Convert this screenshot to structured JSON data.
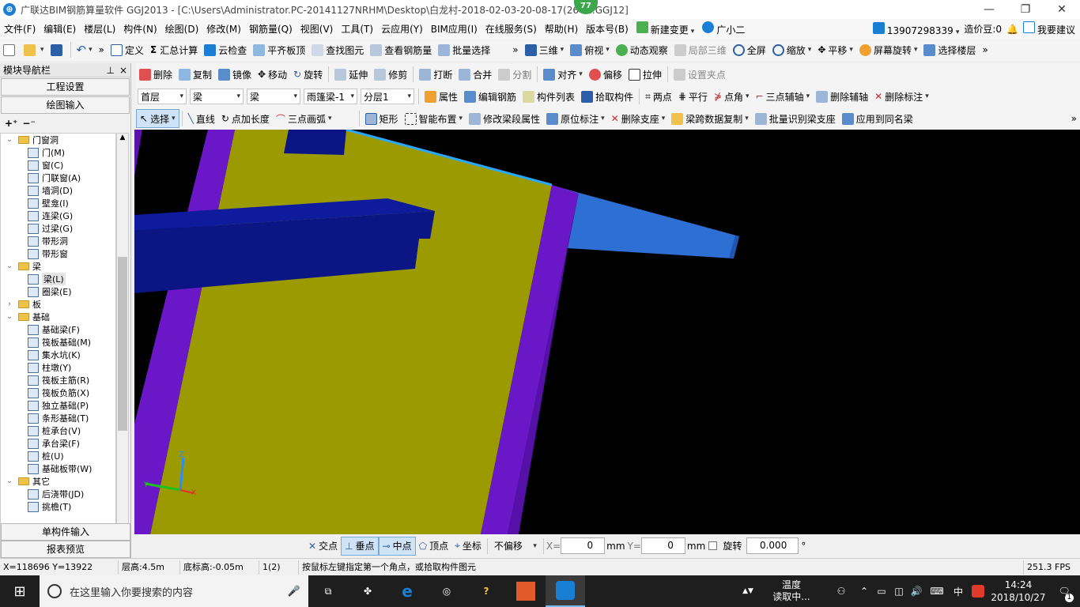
{
  "window": {
    "title": "广联达BIM钢筋算量软件 GGJ2013 - [C:\\Users\\Administrator.PC-20141127NRHM\\Desktop\\白龙村-2018-02-03-20-08-17(26G...GGJ12]",
    "badge": "77",
    "logo_glyph": "⊕"
  },
  "menu": {
    "items": [
      "文件(F)",
      "编辑(E)",
      "楼层(L)",
      "构件(N)",
      "绘图(D)",
      "修改(M)",
      "钢筋量(Q)",
      "视图(V)",
      "工具(T)",
      "云应用(Y)",
      "BIM应用(I)",
      "在线服务(S)",
      "帮助(H)",
      "版本号(B)"
    ],
    "new_change": "新建变更",
    "assistant": "广小二",
    "phone": "13907298339",
    "beans": "造价豆:0",
    "feedback": "我要建议"
  },
  "toolbar1": {
    "items": [
      "定义",
      "汇总计算",
      "云检查",
      "平齐板顶",
      "查找图元",
      "查看钢筋量",
      "批量选择"
    ],
    "view_items": [
      "三维",
      "俯视",
      "动态观察",
      "局部三维",
      "全屏",
      "缩放",
      "平移",
      "屏幕旋转",
      "选择楼层"
    ]
  },
  "toolbar2": {
    "items": [
      "删除",
      "复制",
      "镜像",
      "移动",
      "旋转",
      "延伸",
      "修剪",
      "打断",
      "合并",
      "分割",
      "对齐",
      "偏移",
      "拉伸",
      "设置夹点"
    ]
  },
  "toolbar3": {
    "floor": "首层",
    "type1": "梁",
    "type2": "梁",
    "component": "雨篷梁-1",
    "layer": "分层1",
    "items": [
      "属性",
      "编辑钢筋",
      "构件列表",
      "拾取构件",
      "两点",
      "平行",
      "点角",
      "三点辅轴",
      "删除辅轴",
      "删除标注"
    ]
  },
  "toolbar4": {
    "items": [
      "选择",
      "直线",
      "点加长度",
      "三点画弧",
      "矩形",
      "智能布置",
      "修改梁段属性",
      "原位标注",
      "删除支座",
      "梁跨数据复制",
      "批量识别梁支座",
      "应用到同名梁"
    ]
  },
  "nav": {
    "title": "模块导航栏",
    "pin": "ᅟ",
    "close": "×",
    "btn_project": "工程设置",
    "btn_draw": "绘图输入",
    "btn_single": "单构件输入",
    "btn_report": "报表预览",
    "tree": [
      {
        "label": "门窗洞",
        "type": "folder",
        "open": true,
        "level": 0
      },
      {
        "label": "门(M)",
        "type": "leaf",
        "level": 1
      },
      {
        "label": "窗(C)",
        "type": "leaf",
        "level": 1
      },
      {
        "label": "门联窗(A)",
        "type": "leaf",
        "level": 1
      },
      {
        "label": "墙洞(D)",
        "type": "leaf",
        "level": 1
      },
      {
        "label": "壁龛(I)",
        "type": "leaf",
        "level": 1
      },
      {
        "label": "连梁(G)",
        "type": "leaf",
        "level": 1
      },
      {
        "label": "过梁(G)",
        "type": "leaf",
        "level": 1
      },
      {
        "label": "带形洞",
        "type": "leaf",
        "level": 1
      },
      {
        "label": "带形窗",
        "type": "leaf",
        "level": 1
      },
      {
        "label": "梁",
        "type": "folder",
        "open": true,
        "level": 0
      },
      {
        "label": "梁(L)",
        "type": "leaf",
        "level": 1,
        "selected": true
      },
      {
        "label": "圈梁(E)",
        "type": "leaf",
        "level": 1
      },
      {
        "label": "板",
        "type": "folder",
        "open": false,
        "level": 0
      },
      {
        "label": "基础",
        "type": "folder",
        "open": true,
        "level": 0
      },
      {
        "label": "基础梁(F)",
        "type": "leaf",
        "level": 1
      },
      {
        "label": "筏板基础(M)",
        "type": "leaf",
        "level": 1
      },
      {
        "label": "集水坑(K)",
        "type": "leaf",
        "level": 1
      },
      {
        "label": "柱墩(Y)",
        "type": "leaf",
        "level": 1
      },
      {
        "label": "筏板主筋(R)",
        "type": "leaf",
        "level": 1
      },
      {
        "label": "筏板负筋(X)",
        "type": "leaf",
        "level": 1
      },
      {
        "label": "独立基础(P)",
        "type": "leaf",
        "level": 1
      },
      {
        "label": "条形基础(T)",
        "type": "leaf",
        "level": 1
      },
      {
        "label": "桩承台(V)",
        "type": "leaf",
        "level": 1
      },
      {
        "label": "承台梁(F)",
        "type": "leaf",
        "level": 1
      },
      {
        "label": "桩(U)",
        "type": "leaf",
        "level": 1
      },
      {
        "label": "基础板带(W)",
        "type": "leaf",
        "level": 1
      },
      {
        "label": "其它",
        "type": "folder",
        "open": true,
        "level": 0
      },
      {
        "label": "后浇带(JD)",
        "type": "leaf",
        "level": 1
      },
      {
        "label": "挑檐(T)",
        "type": "leaf",
        "level": 1
      }
    ]
  },
  "axes": {
    "z": "Z",
    "x": "X",
    "y": "Y"
  },
  "snap": {
    "items": [
      "交点",
      "垂点",
      "中点",
      "顶点",
      "坐标"
    ],
    "offset_mode": "不偏移",
    "x_label": "X=",
    "x_value": "0",
    "y_label": "Y=",
    "y_value": "0",
    "unit": "mm",
    "rotate_label": "旋转",
    "rotate_value": "0.000",
    "degree": "°"
  },
  "status": {
    "coords": "X=118696 Y=13922",
    "floor_height": "层高:4.5m",
    "base_height": "底标高:-0.05m",
    "count": "1(2)",
    "hint": "按鼠标左键指定第一个角点，或拾取构件图元",
    "fps": "251.3 FPS"
  },
  "taskbar": {
    "search_placeholder": "在这里输入你要搜索的内容",
    "weather_line1": "温度",
    "weather_line2": "读取中...",
    "ime": "中",
    "time": "14:24",
    "date": "2018/10/27",
    "notify": "1"
  },
  "colors": {
    "slab": "#9b9a00",
    "beam_purple": "#6a17c8",
    "beam_navy": "#0b1584",
    "beam_blue": "#2e6fd4",
    "accent": "#1a7fd4"
  }
}
